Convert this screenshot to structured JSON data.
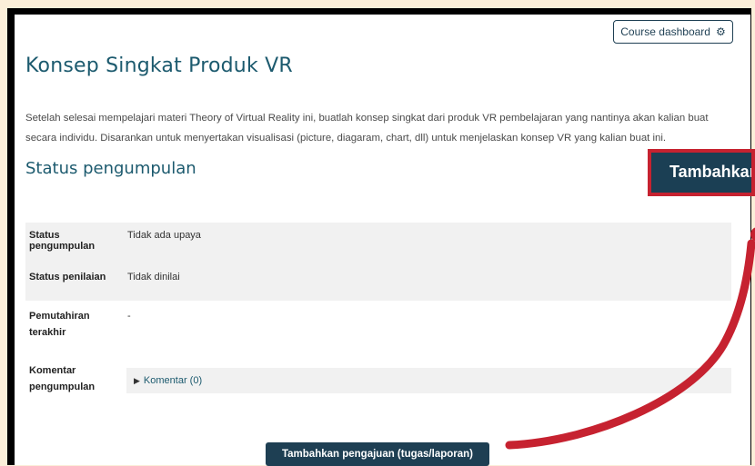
{
  "header": {
    "course_dashboard_label": "Course dashboard",
    "gear_icon": "gear-icon"
  },
  "assignment": {
    "title": "Konsep Singkat Produk VR",
    "description": "Setelah selesai mempelajari materi Theory of Virtual Reality ini, buatlah konsep singkat dari produk VR pembelajaran yang nantinya akan kalian buat secara individu. Disarankan untuk menyertakan visualisasi (picture, diagaram, chart, dll) untuk menjelaskan konsep VR yang kalian buat ini."
  },
  "status": {
    "heading": "Status pengumpulan",
    "rows": [
      {
        "label": "Status pengumpulan",
        "value": "Tidak ada upaya"
      },
      {
        "label": "Status penilaian",
        "value": "Tidak dinilai"
      },
      {
        "label": "Pemutahiran terakhir",
        "value": "-"
      },
      {
        "label": "Komentar pengumpulan",
        "value": ""
      }
    ],
    "comments_toggle": "Komentar (0)"
  },
  "actions": {
    "submit_label": "Tambahkan pengajuan (tugas/laporan)",
    "callout_label": "Tambahkan pengajuan (tugas/laporan)"
  },
  "colors": {
    "accent": "#1e3f53",
    "callout_border": "#c62230",
    "background": "#fbefd9"
  }
}
